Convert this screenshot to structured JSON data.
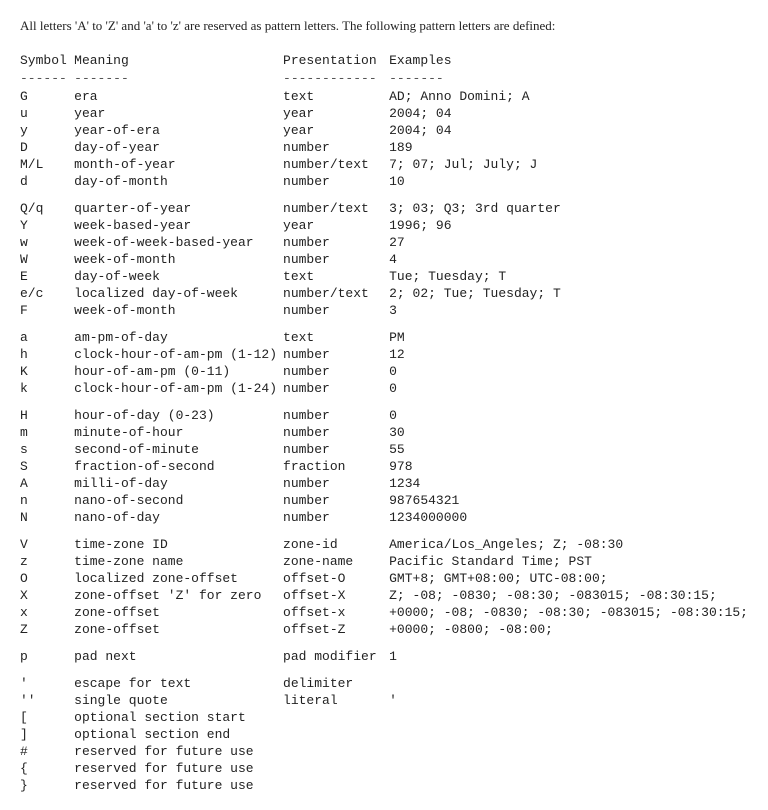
{
  "intro": "All letters 'A' to 'Z' and 'a' to 'z' are reserved as pattern letters. The following pattern letters are defined:",
  "headers": {
    "symbol": "Symbol",
    "meaning": "Meaning",
    "presentation": "Presentation",
    "examples": "Examples"
  },
  "dividers": {
    "symbol": "------",
    "meaning": "-------",
    "presentation": "------------",
    "examples": "-------"
  },
  "rows": [
    {
      "symbol": "G",
      "meaning": "era",
      "presentation": "text",
      "examples": "AD; Anno Domini; A",
      "spacer_after": false
    },
    {
      "symbol": "u",
      "meaning": "year",
      "presentation": "year",
      "examples": "2004; 04",
      "spacer_after": false
    },
    {
      "symbol": "y",
      "meaning": "year-of-era",
      "presentation": "year",
      "examples": "2004; 04",
      "spacer_after": false
    },
    {
      "symbol": "D",
      "meaning": "day-of-year",
      "presentation": "number",
      "examples": "189",
      "spacer_after": false
    },
    {
      "symbol": "M/L",
      "meaning": "month-of-year",
      "presentation": "number/text",
      "examples": "7; 07; Jul; July; J",
      "spacer_after": false
    },
    {
      "symbol": "d",
      "meaning": "day-of-month",
      "presentation": "number",
      "examples": "10",
      "spacer_after": true
    },
    {
      "symbol": "Q/q",
      "meaning": "quarter-of-year",
      "presentation": "number/text",
      "examples": "3; 03; Q3; 3rd quarter",
      "spacer_after": false
    },
    {
      "symbol": "Y",
      "meaning": "week-based-year",
      "presentation": "year",
      "examples": "1996; 96",
      "spacer_after": false
    },
    {
      "symbol": "w",
      "meaning": "week-of-week-based-year",
      "presentation": "number",
      "examples": "27",
      "spacer_after": false
    },
    {
      "symbol": "W",
      "meaning": "week-of-month",
      "presentation": "number",
      "examples": "4",
      "spacer_after": false
    },
    {
      "symbol": "E",
      "meaning": "day-of-week",
      "presentation": "text",
      "examples": "Tue; Tuesday; T",
      "spacer_after": false
    },
    {
      "symbol": "e/c",
      "meaning": "localized day-of-week",
      "presentation": "number/text",
      "examples": "2; 02; Tue; Tuesday; T",
      "spacer_after": false
    },
    {
      "symbol": "F",
      "meaning": "week-of-month",
      "presentation": "number",
      "examples": "3",
      "spacer_after": true
    },
    {
      "symbol": "a",
      "meaning": "am-pm-of-day",
      "presentation": "text",
      "examples": "PM",
      "spacer_after": false
    },
    {
      "symbol": "h",
      "meaning": "clock-hour-of-am-pm (1-12)",
      "presentation": "number",
      "examples": "12",
      "spacer_after": false
    },
    {
      "symbol": "K",
      "meaning": "hour-of-am-pm (0-11)",
      "presentation": "number",
      "examples": "0",
      "spacer_after": false
    },
    {
      "symbol": "k",
      "meaning": "clock-hour-of-am-pm (1-24)",
      "presentation": "number",
      "examples": "0",
      "spacer_after": true
    },
    {
      "symbol": "H",
      "meaning": "hour-of-day (0-23)",
      "presentation": "number",
      "examples": "0",
      "spacer_after": false
    },
    {
      "symbol": "m",
      "meaning": "minute-of-hour",
      "presentation": "number",
      "examples": "30",
      "spacer_after": false
    },
    {
      "symbol": "s",
      "meaning": "second-of-minute",
      "presentation": "number",
      "examples": "55",
      "spacer_after": false
    },
    {
      "symbol": "S",
      "meaning": "fraction-of-second",
      "presentation": "fraction",
      "examples": "978",
      "spacer_after": false
    },
    {
      "symbol": "A",
      "meaning": "milli-of-day",
      "presentation": "number",
      "examples": "1234",
      "spacer_after": false
    },
    {
      "symbol": "n",
      "meaning": "nano-of-second",
      "presentation": "number",
      "examples": "987654321",
      "spacer_after": false
    },
    {
      "symbol": "N",
      "meaning": "nano-of-day",
      "presentation": "number",
      "examples": "1234000000",
      "spacer_after": true
    },
    {
      "symbol": "V",
      "meaning": "time-zone ID",
      "presentation": "zone-id",
      "examples": "America/Los_Angeles; Z; -08:30",
      "spacer_after": false
    },
    {
      "symbol": "z",
      "meaning": "time-zone name",
      "presentation": "zone-name",
      "examples": "Pacific Standard Time; PST",
      "spacer_after": false
    },
    {
      "symbol": "O",
      "meaning": "localized zone-offset",
      "presentation": "offset-O",
      "examples": "GMT+8; GMT+08:00; UTC-08:00;",
      "spacer_after": false
    },
    {
      "symbol": "X",
      "meaning": "zone-offset 'Z' for zero",
      "presentation": "offset-X",
      "examples": "Z; -08; -0830; -08:30; -083015; -08:30:15;",
      "spacer_after": false
    },
    {
      "symbol": "x",
      "meaning": "zone-offset",
      "presentation": "offset-x",
      "examples": "+0000; -08; -0830; -08:30; -083015; -08:30:15;",
      "spacer_after": false
    },
    {
      "symbol": "Z",
      "meaning": "zone-offset",
      "presentation": "offset-Z",
      "examples": "+0000; -0800; -08:00;",
      "spacer_after": true
    },
    {
      "symbol": "p",
      "meaning": "pad next",
      "presentation": "pad modifier",
      "examples": "1",
      "spacer_after": true
    },
    {
      "symbol": "'",
      "meaning": "escape for text",
      "presentation": "delimiter",
      "examples": "",
      "spacer_after": false
    },
    {
      "symbol": "''",
      "meaning": "single quote",
      "presentation": "literal",
      "examples": "'",
      "spacer_after": false
    },
    {
      "symbol": "[",
      "meaning": "optional section start",
      "presentation": "",
      "examples": "",
      "spacer_after": false
    },
    {
      "symbol": "]",
      "meaning": "optional section end",
      "presentation": "",
      "examples": "",
      "spacer_after": false
    },
    {
      "symbol": "#",
      "meaning": "reserved for future use",
      "presentation": "",
      "examples": "",
      "spacer_after": false
    },
    {
      "symbol": "{",
      "meaning": "reserved for future use",
      "presentation": "",
      "examples": "",
      "spacer_after": false
    },
    {
      "symbol": "}",
      "meaning": "reserved for future use",
      "presentation": "",
      "examples": "",
      "spacer_after": false
    }
  ]
}
